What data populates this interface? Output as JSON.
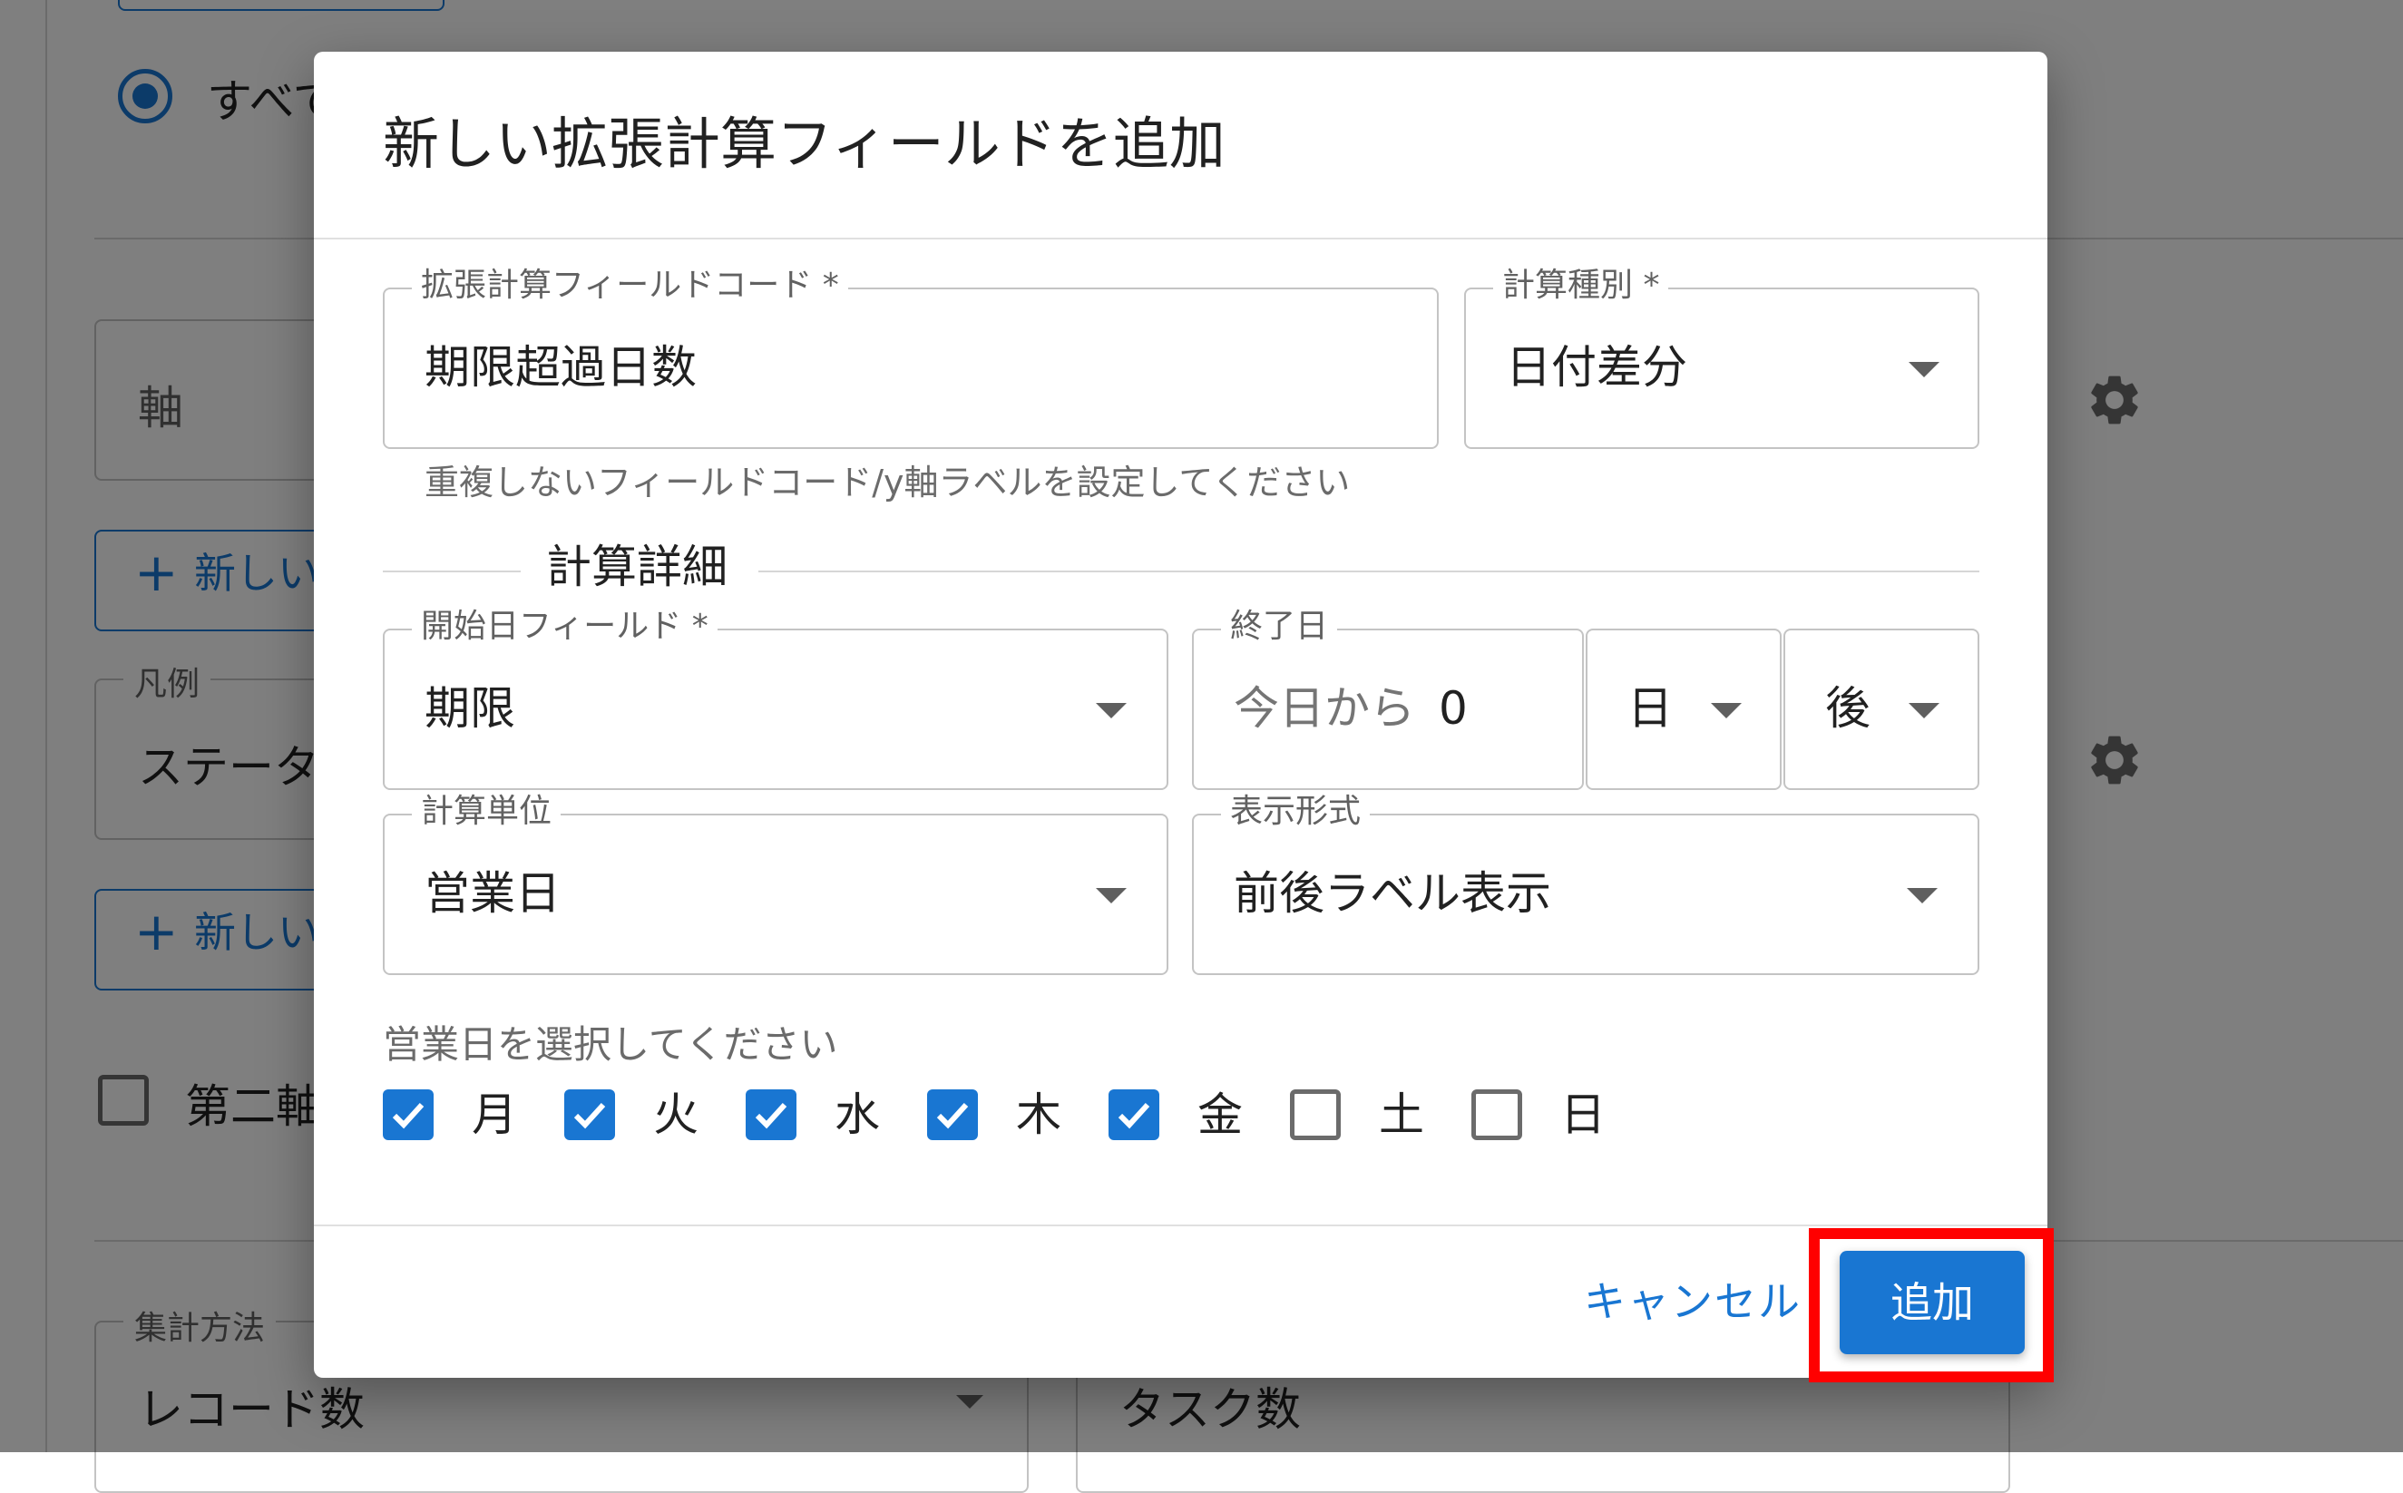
{
  "background": {
    "radio_label": "すべて",
    "axis_field_value": "軸",
    "add_button_1": "新しい",
    "add_button_plus": "+",
    "legend_label": "凡例",
    "legend_value": "ステータス",
    "add_button_2": "新しい",
    "secondary_axis_label": "第二軸",
    "aggregation_label": "集計方法",
    "aggregation_value": "レコード数",
    "count_field_value": "タスク数"
  },
  "dialog": {
    "title": "新しい拡張計算フィールドを追加",
    "field_code": {
      "label": "拡張計算フィールドコード *",
      "value": "期限超過日数",
      "helper": "重複しないフィールドコード/y軸ラベルを設定してください"
    },
    "calc_type": {
      "label": "計算種別 *",
      "value": "日付差分"
    },
    "section_title": "計算詳細",
    "start_field": {
      "label": "開始日フィールド *",
      "value": "期限"
    },
    "end_date": {
      "label": "終了日",
      "prefix": "今日から",
      "offset": "0"
    },
    "end_unit": {
      "value": "日"
    },
    "end_direction": {
      "value": "後"
    },
    "calc_unit": {
      "label": "計算単位",
      "value": "営業日"
    },
    "display_format": {
      "label": "表示形式",
      "value": "前後ラベル表示"
    },
    "business_days": {
      "prompt": "営業日を選択してください",
      "days": [
        {
          "label": "月",
          "checked": true
        },
        {
          "label": "火",
          "checked": true
        },
        {
          "label": "水",
          "checked": true
        },
        {
          "label": "木",
          "checked": true
        },
        {
          "label": "金",
          "checked": true
        },
        {
          "label": "土",
          "checked": false
        },
        {
          "label": "日",
          "checked": false
        }
      ]
    },
    "cancel_label": "キャンセル",
    "add_label": "追加"
  },
  "colors": {
    "primary": "#1976d2",
    "highlight": "#ff0000"
  }
}
